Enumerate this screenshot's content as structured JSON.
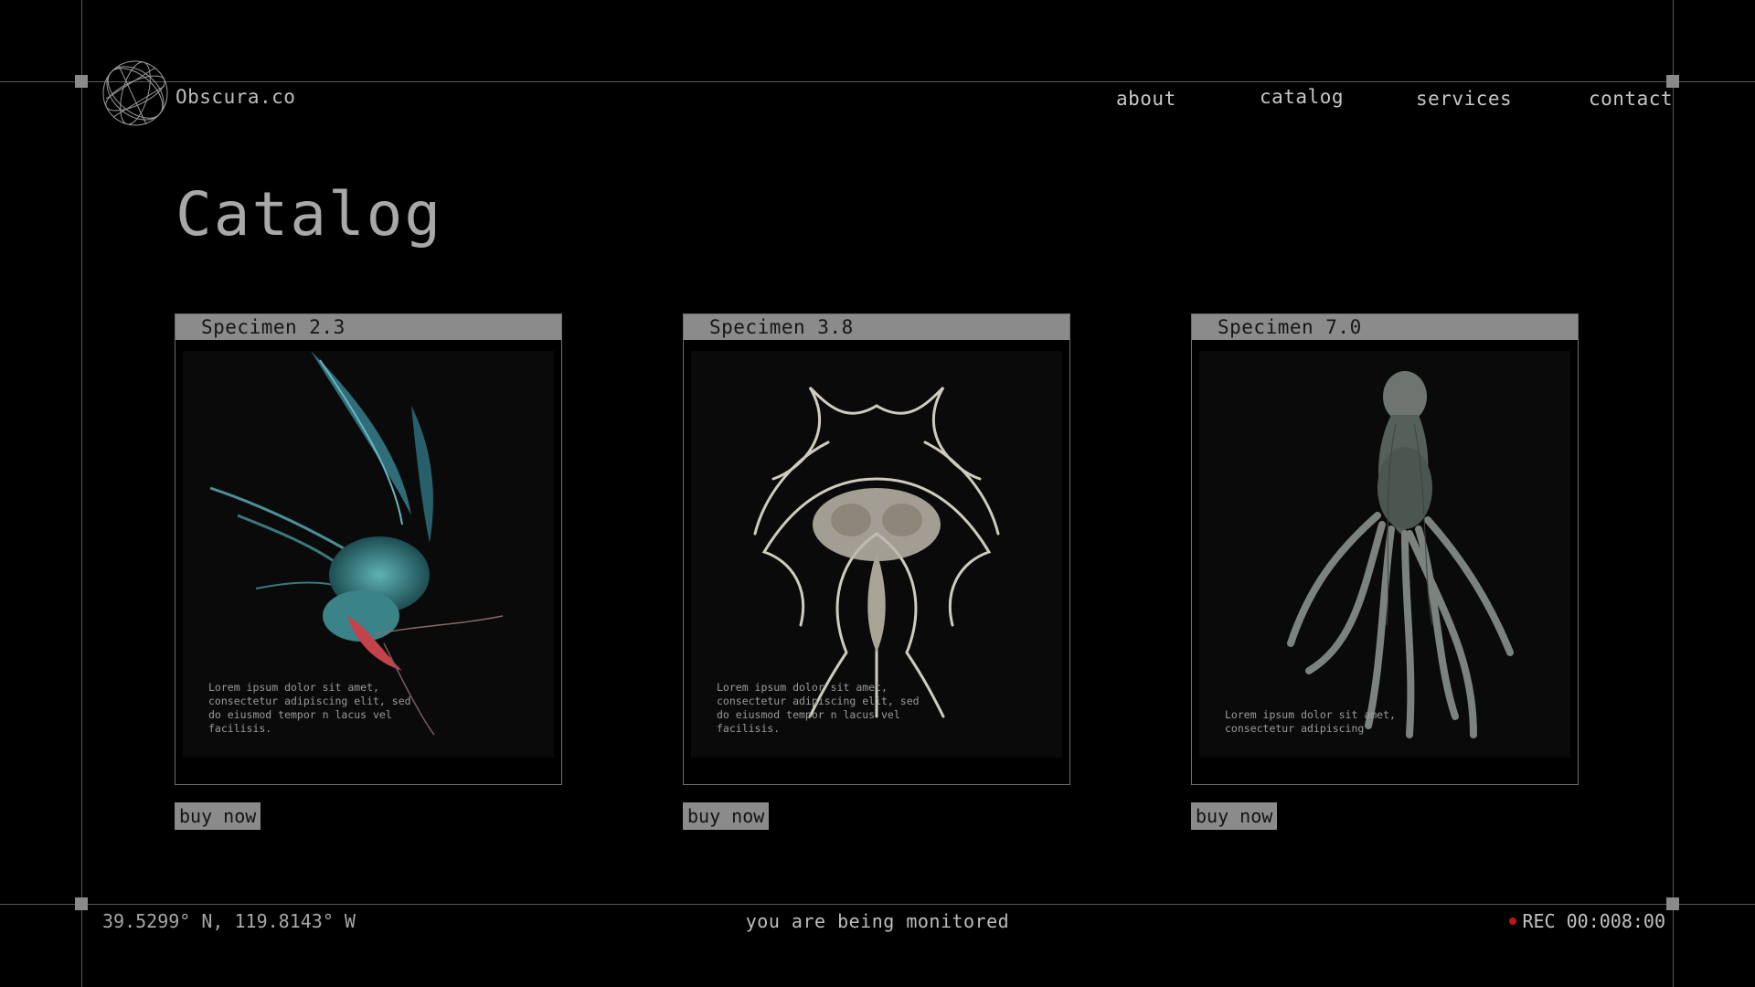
{
  "brand": {
    "name": "Obscura.co"
  },
  "nav": [
    {
      "label": "about"
    },
    {
      "label": "catalog"
    },
    {
      "label": "services"
    },
    {
      "label": "contact"
    }
  ],
  "page": {
    "title": "Catalog"
  },
  "cards": [
    {
      "title": "Specimen 2.3",
      "description": "Lorem ipsum dolor sit amet, consectetur adipiscing elit, sed do eiusmod tempor n lacus vel facilisis.",
      "button": "buy now",
      "image": "teal-winged-creature"
    },
    {
      "title": "Specimen 3.8",
      "description": "Lorem ipsum dolor sit amet, consectetur adipiscing elit, sed do eiusmod tempor n lacus vel facilisis.",
      "button": "buy now",
      "image": "symmetric-bone-creature"
    },
    {
      "title": "Specimen 7.0",
      "description": "Lorem ipsum dolor sit amet, consectetur adipiscing",
      "button": "buy now",
      "image": "tentacled-creature"
    }
  ],
  "footer": {
    "coords": "39.5299° N, 119.8143° W",
    "status": "you are being monitored",
    "rec_label": "REC 00:008:00"
  },
  "colors": {
    "background": "#000000",
    "frame": "#5a5a5a",
    "header_bar": "#8b8b8b",
    "rec_dot": "#c0151a"
  }
}
